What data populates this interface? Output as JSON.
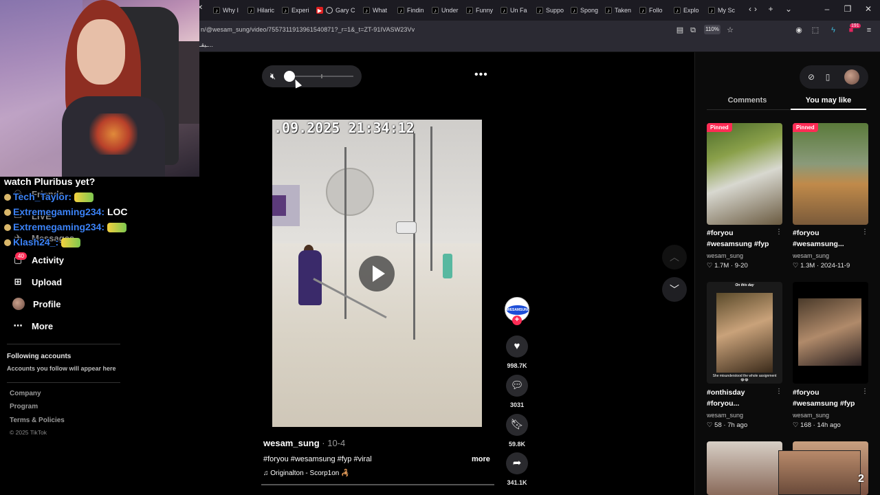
{
  "browser": {
    "tabs": [
      {
        "label": "Why I",
        "icon": "tiktok"
      },
      {
        "label": "Hilaric",
        "icon": "tiktok"
      },
      {
        "label": "Experi",
        "icon": "tiktok"
      },
      {
        "label": "Gary C",
        "icon": "youtube"
      },
      {
        "label": "What",
        "icon": "tiktok"
      },
      {
        "label": "Findin",
        "icon": "tiktok"
      },
      {
        "label": "Under",
        "icon": "tiktok"
      },
      {
        "label": "Funny",
        "icon": "tiktok"
      },
      {
        "label": "Un Fa",
        "icon": "tiktok"
      },
      {
        "label": "Suppo",
        "icon": "tiktok"
      },
      {
        "label": "Spong",
        "icon": "tiktok"
      },
      {
        "label": "Taken",
        "icon": "tiktok"
      },
      {
        "label": "Follo",
        "icon": "tiktok"
      },
      {
        "label": "Explo",
        "icon": "tiktok"
      },
      {
        "label": "My Sc",
        "icon": "tiktok"
      }
    ],
    "url": "n/@wesam_sung/video/7557311913961540871?_r=1&_t=ZT-91IVASW23Vv",
    "zoom": "110%",
    "extension_badge": "191",
    "bookmark_label": "ـيقـ..."
  },
  "chat": [
    {
      "user": "",
      "message": "watch Pluribus yet?"
    },
    {
      "user": "Tech_Taylor:",
      "message": ""
    },
    {
      "user": "Extremegaming234:",
      "message": "LOC"
    },
    {
      "user": "Extremegaming234:",
      "message": ""
    },
    {
      "user": "Klash24_:",
      "message": ""
    }
  ],
  "sidebar": {
    "items": [
      {
        "label": "Friends",
        "icon": "friends-icon"
      },
      {
        "label": "LIVE",
        "icon": "live-icon"
      },
      {
        "label": "Messages",
        "icon": "messages-icon"
      },
      {
        "label": "Activity",
        "icon": "activity-icon",
        "badge": "40"
      },
      {
        "label": "Upload",
        "icon": "upload-icon"
      },
      {
        "label": "Profile",
        "icon": "avatar"
      },
      {
        "label": "More",
        "icon": "more-icon"
      }
    ],
    "following_heading": "Following accounts",
    "following_sub": "Accounts you follow will appear here",
    "footer": [
      "Company",
      "Program",
      "Terms & Policies"
    ],
    "copyright": "© 2025 TikTok"
  },
  "video": {
    "timestamp": ".09.2025 21:34:12",
    "volume_level": 0.0,
    "author": "wesam_sung",
    "date": "10-4",
    "caption": "#foryou #wesamsung #fyp #viral",
    "more_label": "more",
    "sound": "Originalton - Scorp1on 🦂",
    "likes": "998.7K",
    "comments": "3031",
    "saves": "59.8K",
    "shares": "341.1K",
    "creator_logo": "WESAMSUNG"
  },
  "right_panel": {
    "tabs": [
      "Comments",
      "You may like"
    ],
    "active_tab": "You may like",
    "cards": [
      {
        "pinned": "Pinned",
        "title": "#foryou #wesamsung #fyp",
        "user": "wesam_sung",
        "likes": "1.7M",
        "date": "9-20"
      },
      {
        "pinned": "Pinned",
        "title": "#foryou #wesamsung...",
        "user": "wesam_sung",
        "likes": "1.3M",
        "date": "2024-11-9"
      },
      {
        "pinned": "",
        "title": "#onthisday #foryou...",
        "user": "wesam_sung",
        "likes": "58",
        "date": "7h ago",
        "thumb_caption": "On this day",
        "thumb_subcaption": "She misunderstood the whole assignment 😂😂"
      },
      {
        "pinned": "",
        "title": "#foryou #wesamsung #fyp",
        "user": "wesam_sung",
        "likes": "168",
        "date": "14h ago"
      }
    ]
  },
  "overlay": {
    "cam2_number": "2"
  }
}
